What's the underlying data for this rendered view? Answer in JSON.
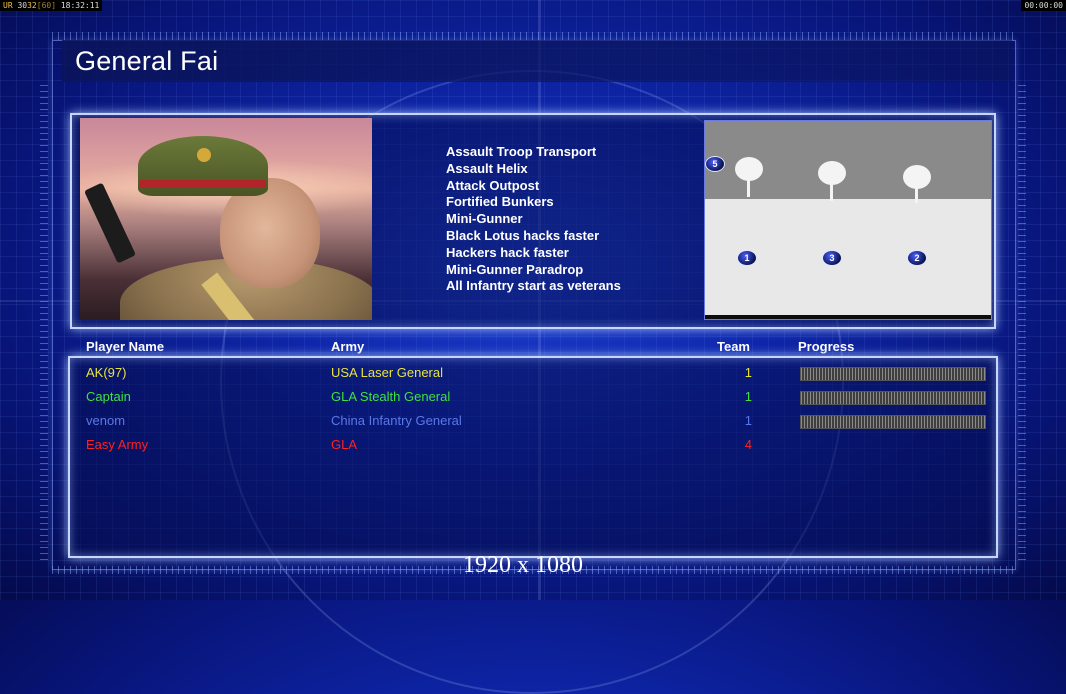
{
  "debug_bar": {
    "fps_prefix": "UR",
    "fps_a": "30",
    "fps_b": "32",
    "fps_c": "[60]",
    "clock": "18:32:11",
    "timer": "00:00:00"
  },
  "title": "General Fai",
  "units": [
    "Assault Troop Transport",
    "Assault Helix",
    "Attack Outpost",
    "Fortified Bunkers",
    "Mini-Gunner",
    "Black Lotus hacks faster",
    "Hackers hack faster",
    "Mini-Gunner Paradrop",
    "All Infantry start as veterans"
  ],
  "map": {
    "markers": [
      "5",
      "1",
      "3",
      "2"
    ]
  },
  "table": {
    "headers": {
      "player": "Player Name",
      "army": "Army",
      "team": "Team",
      "progress": "Progress"
    },
    "rows": [
      {
        "name": "AK(97)",
        "army": "USA Laser General",
        "team": "1",
        "color": "#e8e43a",
        "progress": 1.0
      },
      {
        "name": "Captain",
        "army": "GLA Stealth General",
        "team": "1",
        "color": "#3ee23e",
        "progress": 1.0
      },
      {
        "name": "venom",
        "army": "China Infantry General",
        "team": "1",
        "color": "#5b78e8",
        "progress": 1.0
      },
      {
        "name": "Easy Army",
        "army": "GLA",
        "team": "4",
        "color": "#ff2020",
        "progress": null
      }
    ]
  },
  "resolution": "1920 x 1080"
}
